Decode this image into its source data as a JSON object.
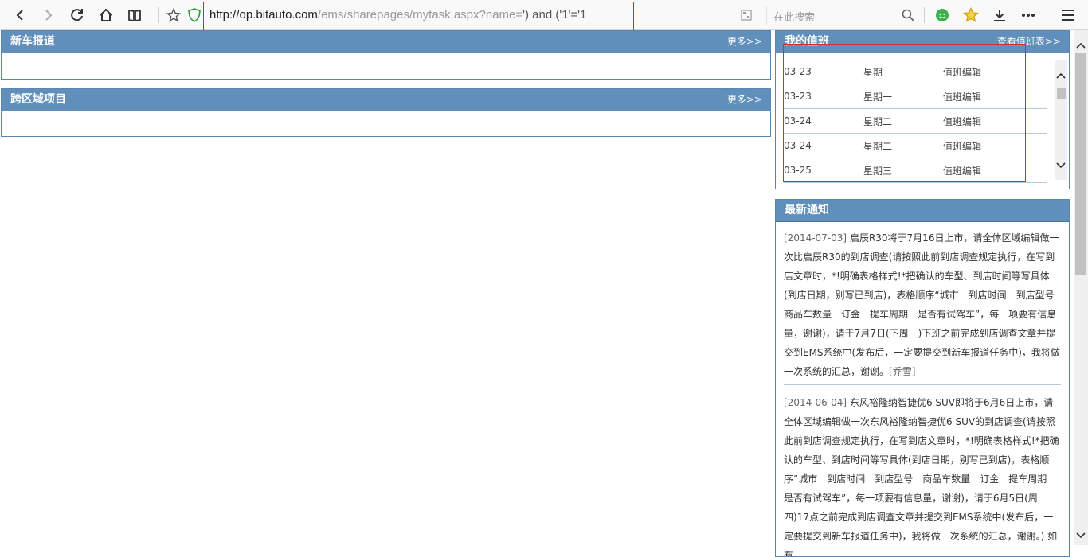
{
  "browser": {
    "url_host": "http://op.bitauto.com",
    "url_path": "/ems/sharepages/mytask.aspx?name=",
    "url_tail": "') and ('1'='1",
    "search_placeholder": "在此搜索"
  },
  "panels": {
    "new_car": {
      "title": "新车报道",
      "more": "更多>>"
    },
    "cross_region": {
      "title": "跨区域项目",
      "more": "更多>>"
    },
    "duty": {
      "title": "我的值班",
      "more": "查看值班表>>",
      "rows": [
        {
          "date": "03-23",
          "weekday": "星期一",
          "role": "值班编辑"
        },
        {
          "date": "03-23",
          "weekday": "星期一",
          "role": "值班编辑"
        },
        {
          "date": "03-24",
          "weekday": "星期二",
          "role": "值班编辑"
        },
        {
          "date": "03-24",
          "weekday": "星期二",
          "role": "值班编辑"
        },
        {
          "date": "03-25",
          "weekday": "星期三",
          "role": "值班编辑"
        }
      ]
    },
    "notice": {
      "title": "最新通知",
      "items": [
        {
          "date": "[2014-07-03]",
          "text": "启辰R30将于7月16日上市，请全体区域编辑做一次比启辰R30的到店调查(请按照此前到店调查规定执行，在写到店文章时，*!明确表格样式!*把确认的车型、到店时间等写具体(到店日期，别写已到店)，表格顺序“城市　到店时间　到店型号　商品车数量　订金　提车周期　是否有试驾车”，每一项要有信息量，谢谢)，请于7月7日(下周一)下班之前完成到店调查文章并提交到EMS系统中(发布后，一定要提交到新车报道任务中)，我将做一次系统的汇总，谢谢。",
          "author": "[乔雪]"
        },
        {
          "date": "[2014-06-04]",
          "text": "东风裕隆纳智捷优6 SUV即将于6月6日上市，请全体区域编辑做一次东风裕隆纳智捷优6 SUV的到店调查(请按照此前到店调查规定执行，在写到店文章时，*!明确表格样式!*把确认的车型、到店时间等写具体(到店日期，别写已到店)，表格顺序“城市　到店时间　到店型号　商品车数量　订金　提车周期　是否有试驾车”，每一项要有信息量，谢谢)，请于6月5日(周四)17点之前完成到店调查文章并提交到EMS系统中(发布后，一定要提交到新车报道任务中)，我将做一次系统的汇总，谢谢。) 如有",
          "author": ""
        }
      ]
    }
  }
}
